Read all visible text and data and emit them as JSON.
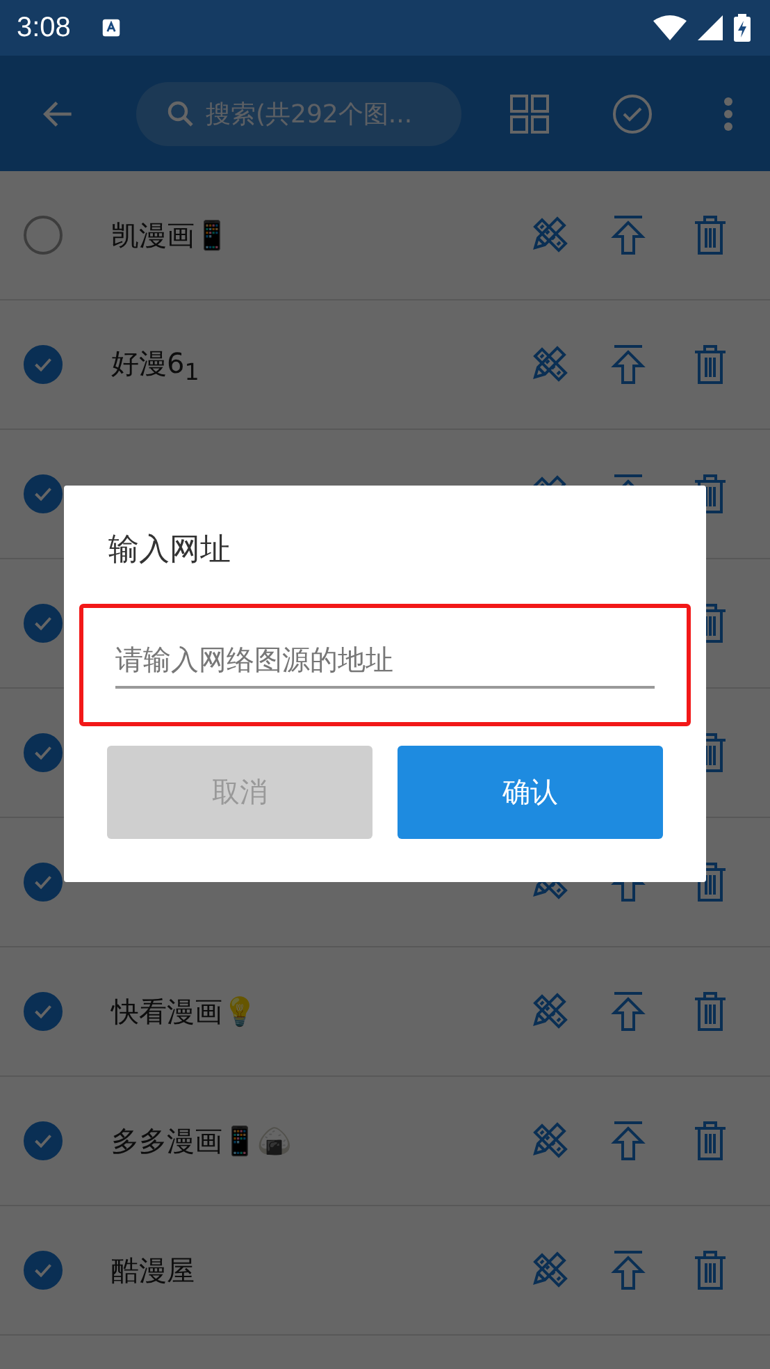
{
  "status_bar": {
    "time": "3:08"
  },
  "toolbar": {
    "search": {
      "placeholder": "搜索(共292个图..."
    }
  },
  "sources": [
    {
      "name": "凯漫画📱",
      "checked": false,
      "actions": [
        {
          "kind": "edit"
        },
        {
          "kind": "move_top"
        },
        {
          "kind": "delete"
        }
      ]
    },
    {
      "name": "好漫6$_{1}$",
      "checked": true,
      "actions": [
        {
          "kind": "edit"
        },
        {
          "kind": "move_top"
        },
        {
          "kind": "delete"
        }
      ]
    },
    {
      "checked": true,
      "actions": [
        {
          "kind": "edit"
        },
        {
          "kind": "move_top"
        },
        {
          "kind": "delete"
        }
      ]
    },
    {
      "checked": true,
      "actions": [
        {
          "kind": "delete"
        }
      ]
    },
    {
      "checked": true,
      "actions": [
        {
          "kind": "delete"
        }
      ]
    },
    {
      "checked": true,
      "actions": [
        {
          "kind": "edit"
        },
        {
          "kind": "move_top"
        },
        {
          "kind": "delete"
        }
      ]
    },
    {
      "name": "快看漫画💡",
      "checked": true,
      "actions": [
        {
          "kind": "edit"
        },
        {
          "kind": "move_top"
        },
        {
          "kind": "delete"
        }
      ]
    },
    {
      "name": "多多漫画📱🍙",
      "checked": true,
      "actions": [
        {
          "kind": "edit"
        },
        {
          "kind": "move_top"
        },
        {
          "kind": "delete"
        }
      ]
    },
    {
      "name": "酷漫屋",
      "checked": true,
      "actions": [
        {
          "kind": "edit"
        },
        {
          "kind": "move_top"
        },
        {
          "kind": "delete"
        }
      ]
    }
  ],
  "dialog": {
    "title": "输入网址",
    "field": {
      "placeholder": "请输入网络图源的地址",
      "highlighted": true
    },
    "buttons": [
      {
        "label": "取消",
        "kind": "secondary"
      },
      {
        "label": "确认",
        "kind": "primary"
      }
    ]
  }
}
